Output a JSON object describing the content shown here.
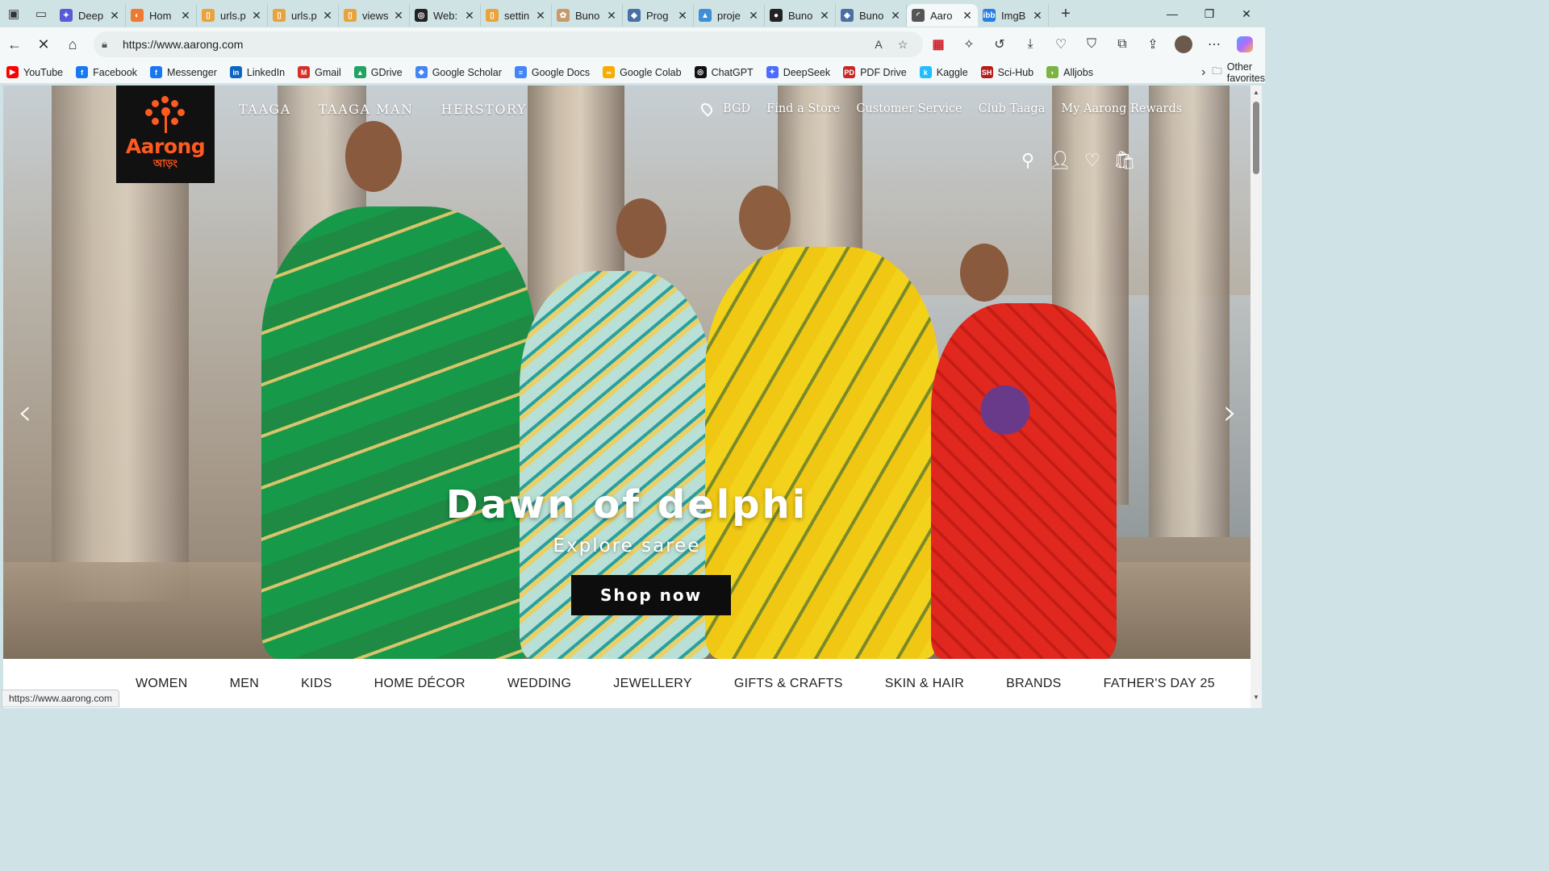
{
  "browser": {
    "tabs": [
      {
        "title": "Deep",
        "color": "#5a5ad6",
        "glyph": "✦"
      },
      {
        "title": "Hom",
        "color": "#f07830",
        "glyph": "◐"
      },
      {
        "title": "urls.p",
        "color": "#e8a33c",
        "glyph": "▯"
      },
      {
        "title": "urls.p",
        "color": "#e8a33c",
        "glyph": "▯"
      },
      {
        "title": "views",
        "color": "#e8a33c",
        "glyph": "▯"
      },
      {
        "title": "Web:",
        "color": "#222222",
        "glyph": "◎"
      },
      {
        "title": "settin",
        "color": "#e8a33c",
        "glyph": "▯"
      },
      {
        "title": "Buno",
        "color": "#c79a6e",
        "glyph": "✿"
      },
      {
        "title": "Prog",
        "color": "#4a6fa5",
        "glyph": "◆"
      },
      {
        "title": "proje",
        "color": "#3f8fd6",
        "glyph": "▲"
      },
      {
        "title": "Buno",
        "color": "#222222",
        "glyph": "●"
      },
      {
        "title": "Buno",
        "color": "#4a6fa5",
        "glyph": "◆"
      },
      {
        "title": "Aaro",
        "color": "#555555",
        "glyph": "◜"
      },
      {
        "title": "ImgB",
        "color": "#2a7de1",
        "glyph": "ibb"
      }
    ],
    "url": "https://www.aarong.com",
    "bookmarks": [
      {
        "label": "YouTube",
        "color": "#ff0000",
        "glyph": "▶"
      },
      {
        "label": "Facebook",
        "color": "#1877f2",
        "glyph": "f"
      },
      {
        "label": "Messenger",
        "color": "#1877f2",
        "glyph": "f"
      },
      {
        "label": "LinkedIn",
        "color": "#0a66c2",
        "glyph": "in"
      },
      {
        "label": "Gmail",
        "color": "#d93025",
        "glyph": "M"
      },
      {
        "label": "GDrive",
        "color": "#1fa463",
        "glyph": "▲"
      },
      {
        "label": "Google Scholar",
        "color": "#4285f4",
        "glyph": "◆"
      },
      {
        "label": "Google Docs",
        "color": "#4285f4",
        "glyph": "≡"
      },
      {
        "label": "Google Colab",
        "color": "#f9ab00",
        "glyph": "∞"
      },
      {
        "label": "ChatGPT",
        "color": "#111111",
        "glyph": "◎"
      },
      {
        "label": "DeepSeek",
        "color": "#4d6bfe",
        "glyph": "✦"
      },
      {
        "label": "PDF Drive",
        "color": "#c62828",
        "glyph": "PD"
      },
      {
        "label": "Kaggle",
        "color": "#20beff",
        "glyph": "k"
      },
      {
        "label": "Sci-Hub",
        "color": "#b71c1c",
        "glyph": "SH"
      },
      {
        "label": "Alljobs",
        "color": "#7cb342",
        "glyph": "◗"
      }
    ],
    "other_favorites": "Other favorites",
    "status_url": "https://www.aarong.com"
  },
  "site": {
    "logo_text": "Aarong",
    "logo_bangla": "আড়ং",
    "nav_left": [
      "TAAGA",
      "TAAGA MAN",
      "HERSTORY"
    ],
    "region": "BGD",
    "nav_right": [
      "Find a Store",
      "Customer Service",
      "Club Taaga",
      "My Aarong Rewards"
    ],
    "hero_title": "Dawn of delphi",
    "hero_subtitle": "Explore saree",
    "cta": "Shop now",
    "categories": [
      "WOMEN",
      "MEN",
      "KIDS",
      "HOME DÉCOR",
      "WEDDING",
      "JEWELLERY",
      "GIFTS & CRAFTS",
      "SKIN & HAIR",
      "BRANDS",
      "FATHER'S DAY 25"
    ],
    "accent": "#ff5a1f"
  }
}
